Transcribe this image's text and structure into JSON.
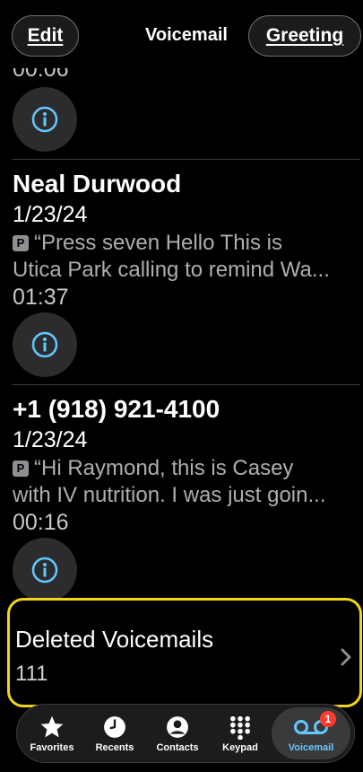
{
  "header": {
    "edit_label": "Edit",
    "title": "Voicemail",
    "greeting_label": "Greeting"
  },
  "voicemails": [
    {
      "duration": "00:06"
    },
    {
      "caller": "Neal Durwood",
      "date": "1/23/24",
      "transcript_line1": "“Press seven Hello This is",
      "transcript_line2": "Utica Park calling to remind Wa...",
      "duration": "01:37"
    },
    {
      "caller": "+1 (918) 921-4100",
      "date": "1/23/24",
      "transcript_line1": "“Hi Raymond, this is Casey",
      "transcript_line2": "with IV nutrition. I was just goin...",
      "duration": "00:16"
    }
  ],
  "transcript_badge": "P",
  "deleted": {
    "title": "Deleted Voicemails",
    "count": "111"
  },
  "tabs": [
    {
      "label": "Favorites",
      "icon": "star-icon"
    },
    {
      "label": "Recents",
      "icon": "clock-icon"
    },
    {
      "label": "Contacts",
      "icon": "person-icon"
    },
    {
      "label": "Keypad",
      "icon": "keypad-icon"
    },
    {
      "label": "Voicemail",
      "icon": "voicemail-icon",
      "badge": "1",
      "active": true
    }
  ],
  "colors": {
    "accent": "#64c8ff",
    "highlight": "#f2d51b",
    "badge": "#ff3b30"
  }
}
